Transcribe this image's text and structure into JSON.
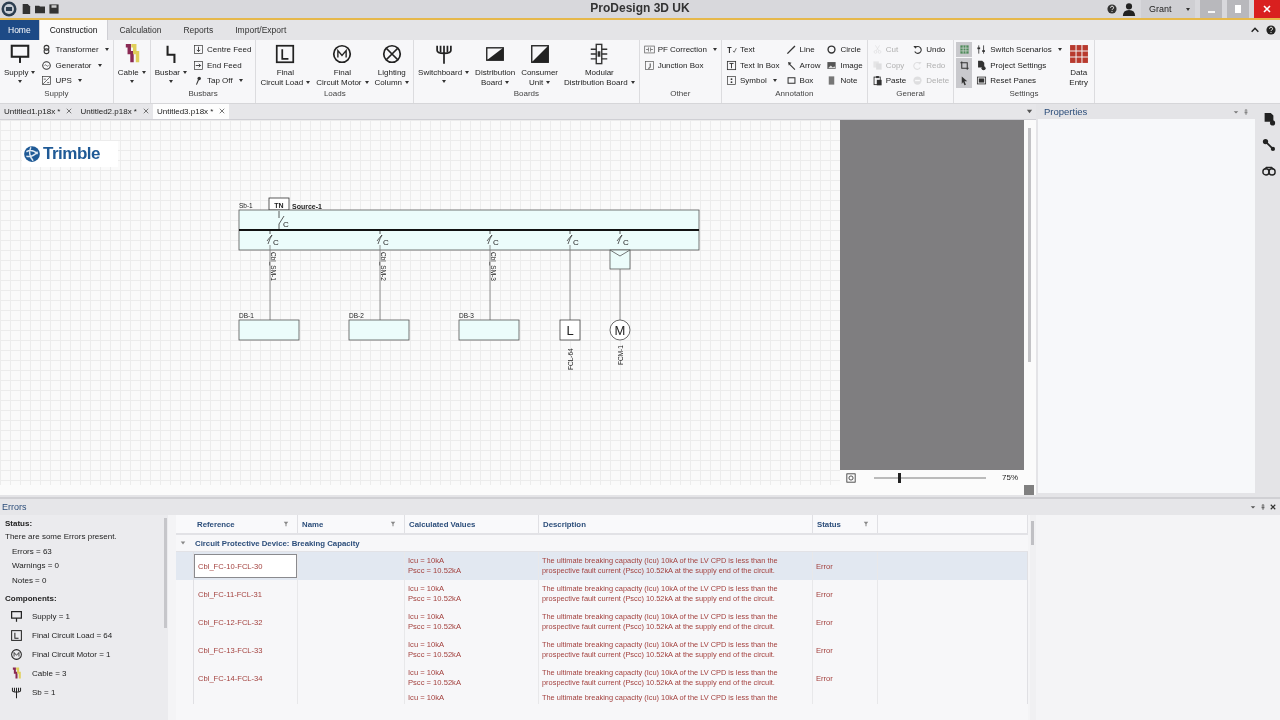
{
  "window": {
    "title": "ProDesign 3D UK",
    "user": "Grant"
  },
  "ribbon_tabs": [
    {
      "label": "Home",
      "kind": "app",
      "selected": false
    },
    {
      "label": "Construction",
      "kind": "tab",
      "selected": true
    },
    {
      "label": "Calculation",
      "kind": "tab",
      "selected": false
    },
    {
      "label": "Reports",
      "kind": "tab",
      "selected": false
    },
    {
      "label": "Import/Export",
      "kind": "tab",
      "selected": false
    }
  ],
  "ribbon_groups": [
    {
      "label": "Supply",
      "items": [
        {
          "kind": "large",
          "lines": [
            "Supply"
          ],
          "dropdown": true,
          "disabled": false,
          "on": false
        },
        {
          "kind": "small",
          "lines": [
            "Transformer"
          ],
          "dropdown": true,
          "disabled": false,
          "on": false
        },
        {
          "kind": "small",
          "lines": [
            "Generator"
          ],
          "dropdown": true,
          "disabled": false,
          "on": false
        },
        {
          "kind": "small",
          "lines": [
            "UPS"
          ],
          "dropdown": true,
          "disabled": false,
          "on": false
        }
      ]
    },
    {
      "items": [
        {
          "kind": "large",
          "lines": [
            "Cable"
          ],
          "dropdown": true,
          "disabled": false,
          "on": false
        }
      ]
    },
    {
      "label": "Busbars",
      "items": [
        {
          "kind": "large",
          "lines": [
            "Busbar"
          ],
          "dropdown": true,
          "disabled": false,
          "on": false
        },
        {
          "kind": "small",
          "lines": [
            "Centre Feed"
          ],
          "dropdown": false,
          "disabled": false,
          "on": false
        },
        {
          "kind": "small",
          "lines": [
            "End Feed"
          ],
          "dropdown": false,
          "disabled": false,
          "on": false
        },
        {
          "kind": "small",
          "lines": [
            "Tap Off"
          ],
          "dropdown": true,
          "disabled": false,
          "on": false
        }
      ]
    },
    {
      "label": "Loads",
      "items": [
        {
          "kind": "large",
          "lines": [
            "Final",
            "Circuit Load"
          ],
          "dropdown": true,
          "disabled": false,
          "on": false
        },
        {
          "kind": "large",
          "lines": [
            "Final",
            "Circuit Motor"
          ],
          "dropdown": true,
          "disabled": false,
          "on": false
        },
        {
          "kind": "large",
          "lines": [
            "Lighting",
            "Column"
          ],
          "dropdown": true,
          "disabled": false,
          "on": false
        }
      ]
    },
    {
      "label": "Boards",
      "items": [
        {
          "kind": "large",
          "lines": [
            "Switchboard"
          ],
          "dropdown": true,
          "disabled": false,
          "on": false
        },
        {
          "kind": "large",
          "lines": [
            "Distribution",
            "Board"
          ],
          "dropdown": true,
          "disabled": false,
          "on": false
        },
        {
          "kind": "large",
          "lines": [
            "Consumer",
            "Unit"
          ],
          "dropdown": true,
          "disabled": false,
          "on": false
        },
        {
          "kind": "large",
          "lines": [
            "Modular",
            "Distribution Board"
          ],
          "dropdown": true,
          "disabled": false,
          "on": false
        }
      ]
    },
    {
      "label": "Other",
      "items": [
        {
          "kind": "small",
          "lines": [
            "PF Correction"
          ],
          "dropdown": true,
          "disabled": false,
          "on": false
        },
        {
          "kind": "small",
          "lines": [
            "Junction Box"
          ],
          "dropdown": false,
          "disabled": false,
          "on": false
        }
      ]
    },
    {
      "label": "Annotation",
      "items": [
        {
          "kind": "small",
          "lines": [
            "Text"
          ],
          "dropdown": false,
          "disabled": false,
          "on": false
        },
        {
          "kind": "small",
          "lines": [
            "Text In Box"
          ],
          "dropdown": false,
          "disabled": false,
          "on": false
        },
        {
          "kind": "small",
          "lines": [
            "Symbol"
          ],
          "dropdown": true,
          "disabled": false,
          "on": false
        },
        {
          "kind": "small",
          "lines": [
            "Line"
          ],
          "dropdown": false,
          "disabled": false,
          "on": false
        },
        {
          "kind": "small",
          "lines": [
            "Arrow"
          ],
          "dropdown": false,
          "disabled": false,
          "on": false
        },
        {
          "kind": "small",
          "lines": [
            "Box"
          ],
          "dropdown": false,
          "disabled": false,
          "on": false
        },
        {
          "kind": "small",
          "lines": [
            "Circle"
          ],
          "dropdown": false,
          "disabled": false,
          "on": false
        },
        {
          "kind": "small",
          "lines": [
            "Image"
          ],
          "dropdown": false,
          "disabled": false,
          "on": false
        },
        {
          "kind": "small",
          "lines": [
            "Note"
          ],
          "dropdown": false,
          "disabled": false,
          "on": false
        }
      ]
    },
    {
      "label": "General",
      "items": [
        {
          "kind": "small",
          "lines": [
            "Cut"
          ],
          "dropdown": false,
          "disabled": true,
          "on": false
        },
        {
          "kind": "small",
          "lines": [
            "Copy"
          ],
          "dropdown": false,
          "disabled": true,
          "on": false
        },
        {
          "kind": "small",
          "lines": [
            "Paste"
          ],
          "dropdown": false,
          "disabled": false,
          "on": false
        },
        {
          "kind": "small",
          "lines": [
            "Undo"
          ],
          "dropdown": false,
          "disabled": false,
          "on": false
        },
        {
          "kind": "small",
          "lines": [
            "Redo"
          ],
          "dropdown": false,
          "disabled": true,
          "on": false
        },
        {
          "kind": "small",
          "lines": [
            "Delete"
          ],
          "dropdown": false,
          "disabled": true,
          "on": false
        }
      ]
    },
    {
      "label": "Settings",
      "items": [
        {
          "kind": "icon",
          "dropdown": false,
          "disabled": false,
          "on": true
        },
        {
          "kind": "icon",
          "dropdown": false,
          "disabled": false,
          "on": true
        },
        {
          "kind": "icon",
          "dropdown": false,
          "disabled": false,
          "on": true
        },
        {
          "kind": "small",
          "lines": [
            "Switch Scenarios"
          ],
          "dropdown": true,
          "disabled": false,
          "on": false
        },
        {
          "kind": "small",
          "lines": [
            "Project Settings"
          ],
          "dropdown": false,
          "disabled": false,
          "on": false
        },
        {
          "kind": "small",
          "lines": [
            "Reset Panes"
          ],
          "dropdown": false,
          "disabled": false,
          "on": false
        },
        {
          "kind": "large",
          "lines": [
            "Data",
            "Entry"
          ],
          "dropdown": false,
          "disabled": false,
          "on": false
        }
      ]
    }
  ],
  "documents": [
    {
      "label": "Untitled1.p18x *",
      "selected": false
    },
    {
      "label": "Untitled2.p18x *",
      "selected": false
    },
    {
      "label": "Untitled3.p18x *",
      "selected": true
    }
  ],
  "logo": "Trimble",
  "diagram": {
    "switchboard": "Sb-1",
    "earthing": "TN",
    "source": "Source-1",
    "source_breaker": "C",
    "circuits": [
      {
        "kind": "board",
        "breaker": "C",
        "cable": "Cbl_SM-1",
        "label": "DB-1"
      },
      {
        "kind": "board",
        "breaker": "C",
        "cable": "Cbl_SM-2",
        "label": "DB-2"
      },
      {
        "kind": "board",
        "breaker": "C",
        "cable": "Cbl_SM-3",
        "label": "DB-3"
      },
      {
        "kind": "load",
        "breaker": "C",
        "symbol": "L",
        "label": "FCL-64"
      },
      {
        "kind": "motor",
        "breaker": "C",
        "symbol": "M",
        "label": "FCM-1"
      }
    ]
  },
  "zoom": {
    "level": 0.22,
    "reading": "75%"
  },
  "properties": {
    "title": "Properties"
  },
  "errors": {
    "title": "Errors",
    "status_heading": "Status:",
    "status_text": "There are some Errors present.",
    "counts": [
      "Errors = 63",
      "Warnings = 0",
      "Notes = 0"
    ],
    "components_heading": "Components:",
    "components": [
      "Supply = 1",
      "Final Circuit Load = 64",
      "Final Circuit Motor = 1",
      "Cable = 3",
      "Sb = 1"
    ],
    "table": {
      "columns": [
        {
          "label": "Reference",
          "filter": true
        },
        {
          "label": "Name",
          "filter": true
        },
        {
          "label": "Calculated Values",
          "filter": false
        },
        {
          "label": "Description",
          "filter": false
        },
        {
          "label": "Status",
          "filter": true
        }
      ],
      "group": {
        "label": "Circuit Protective Device: Breaking Capacity",
        "expanded": true
      },
      "rows": [
        {
          "reference": "Cbl_FC-10-FCL-30",
          "calculated": [
            "Icu = 10kA",
            "Pscc = 10.52kA"
          ],
          "description": "The ultimate breaking capacity (Icu) 10kA of the LV CPD is less than the prospective fault current (Pscc) 10.52kA at the supply end of the circuit.",
          "status": "Error",
          "selected": true
        },
        {
          "reference": "Cbl_FC-11-FCL-31",
          "calculated": [
            "Icu = 10kA",
            "Pscc = 10.52kA"
          ],
          "description": "The ultimate breaking capacity (Icu) 10kA of the LV CPD is less than the prospective fault current (Pscc) 10.52kA at the supply end of the circuit.",
          "status": "Error",
          "selected": false
        },
        {
          "reference": "Cbl_FC-12-FCL-32",
          "calculated": [
            "Icu = 10kA",
            "Pscc = 10.52kA"
          ],
          "description": "The ultimate breaking capacity (Icu) 10kA of the LV CPD is less than the prospective fault current (Pscc) 10.52kA at the supply end of the circuit.",
          "status": "Error",
          "selected": false
        },
        {
          "reference": "Cbl_FC-13-FCL-33",
          "calculated": [
            "Icu = 10kA",
            "Pscc = 10.52kA"
          ],
          "description": "The ultimate breaking capacity (Icu) 10kA of the LV CPD is less than the prospective fault current (Pscc) 10.52kA at the supply end of the circuit.",
          "status": "Error",
          "selected": false
        },
        {
          "reference": "Cbl_FC-14-FCL-34",
          "calculated": [
            "Icu = 10kA",
            "Pscc = 10.52kA"
          ],
          "description": "The ultimate breaking capacity (Icu) 10kA of the LV CPD is less than the prospective fault current (Pscc) 10.52kA at the supply end of the circuit.",
          "status": "Error",
          "selected": false
        },
        {
          "calculated": [
            "Icu = 10kA"
          ],
          "description": "The ultimate breaking capacity (Icu) 10kA of the LV CPD is less than the",
          "selected": false
        }
      ]
    }
  }
}
